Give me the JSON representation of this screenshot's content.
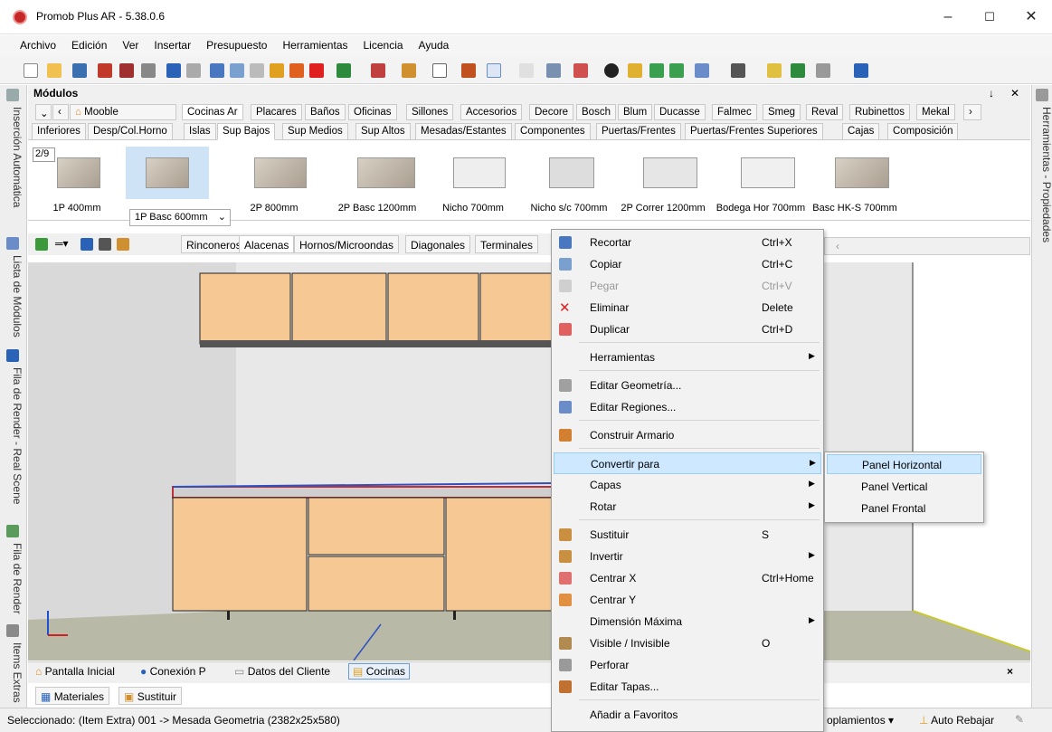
{
  "window": {
    "title": "Promob Plus AR - 5.38.0.6",
    "minimize": "–",
    "maximize": "☐",
    "close": "✕"
  },
  "menu": [
    "Archivo",
    "Edición",
    "Ver",
    "Insertar",
    "Presupuesto",
    "Herramientas",
    "Licencia",
    "Ayuda"
  ],
  "left_rail": [
    "Inserción Automática",
    "Lista de Módulos",
    "Fila de Render - Real Scene",
    "Fila de Render",
    "Items Extras"
  ],
  "right_rail": "Herramientas - Propiedades",
  "modules_panel": {
    "title": "Módulos",
    "pin": "↓",
    "close": "✕",
    "library": "Mooble",
    "brands": [
      "Cocinas Ar",
      "Placares",
      "Baños",
      "Oficinas",
      "Sillones",
      "Accesorios",
      "Decore",
      "Bosch",
      "Blum",
      "Ducasse",
      "Falmec",
      "Smeg",
      "Reval",
      "Rubinettos",
      "Mekal"
    ],
    "categories": [
      "Inferiores",
      "Desp/Col.Horno",
      "Islas",
      "Sup Bajos",
      "Sup Medios",
      "Sup Altos",
      "Mesadas/Estantes",
      "Componentes",
      "Puertas/Frentes",
      "Puertas/Frentes Superiores",
      "Cajas",
      "Composición"
    ],
    "active_category": "Sup Bajos",
    "page": "2/9",
    "items": [
      "1P 400mm",
      "1P Basc 600mm",
      "2P 800mm",
      "2P Basc 1200mm",
      "Nicho 700mm",
      "Nicho s/c 700mm",
      "2P Correr 1200mm",
      "Bodega Hor 700mm",
      "Basc HK-S 700mm"
    ]
  },
  "view_tabs": [
    "Rinconeros",
    "Alacenas",
    "Hornos/Microondas",
    "Diagonales",
    "Terminales"
  ],
  "documents": [
    "Pantalla Inicial",
    "Conexión P",
    "Datos del Cliente",
    "Cocinas"
  ],
  "bottom_tabs": [
    "Materiales",
    "Sustituir"
  ],
  "status": {
    "text": "Seleccionado: (Item Extra) 001 -> Mesada Geometria (2382x25x580)",
    "right1": "oplamientos",
    "right2": "Auto Rebajar"
  },
  "context_menu": {
    "items": [
      {
        "label": "Recortar",
        "shortcut": "Ctrl+X",
        "icon": "scissors-icon"
      },
      {
        "label": "Copiar",
        "shortcut": "Ctrl+C",
        "icon": "copy-icon"
      },
      {
        "label": "Pegar",
        "shortcut": "Ctrl+V",
        "icon": "paste-icon",
        "disabled": true
      },
      {
        "label": "Eliminar",
        "shortcut": "Delete",
        "icon": "delete-icon"
      },
      {
        "label": "Duplicar",
        "shortcut": "Ctrl+D",
        "icon": "duplicate-icon"
      },
      {
        "label": "Herramientas",
        "submenu": true
      },
      {
        "label": "Editar Geometría...",
        "icon": "geometry-icon"
      },
      {
        "label": "Editar Regiones...",
        "icon": "regions-icon"
      },
      {
        "label": "Construir Armario",
        "icon": "wardrobe-icon"
      },
      {
        "label": "Convertir para",
        "submenu": true
      },
      {
        "label": "Capas",
        "submenu": true
      },
      {
        "label": "Rotar",
        "submenu": true
      },
      {
        "label": "Sustituir",
        "shortcut": "S",
        "icon": "replace-icon"
      },
      {
        "label": "Invertir",
        "submenu": true,
        "icon": "invert-icon"
      },
      {
        "label": "Centrar X",
        "shortcut": "Ctrl+Home",
        "icon": "center-x-icon"
      },
      {
        "label": "Centrar Y",
        "icon": "center-y-icon"
      },
      {
        "label": "Dimensión Máxima",
        "submenu": true
      },
      {
        "label": "Visible / Invisible",
        "shortcut": "O",
        "icon": "visibility-icon"
      },
      {
        "label": "Perforar",
        "icon": "drill-icon"
      },
      {
        "label": "Editar Tapas...",
        "icon": "caps-icon"
      },
      {
        "label": "Añadir a Favoritos"
      }
    ],
    "submenu_arrow": "▶"
  },
  "submenu": [
    "Panel Horizontal",
    "Panel Vertical",
    "Panel Frontal"
  ],
  "colors": {
    "cabinet": "#f5c894",
    "highlight": "#cde8ff"
  }
}
